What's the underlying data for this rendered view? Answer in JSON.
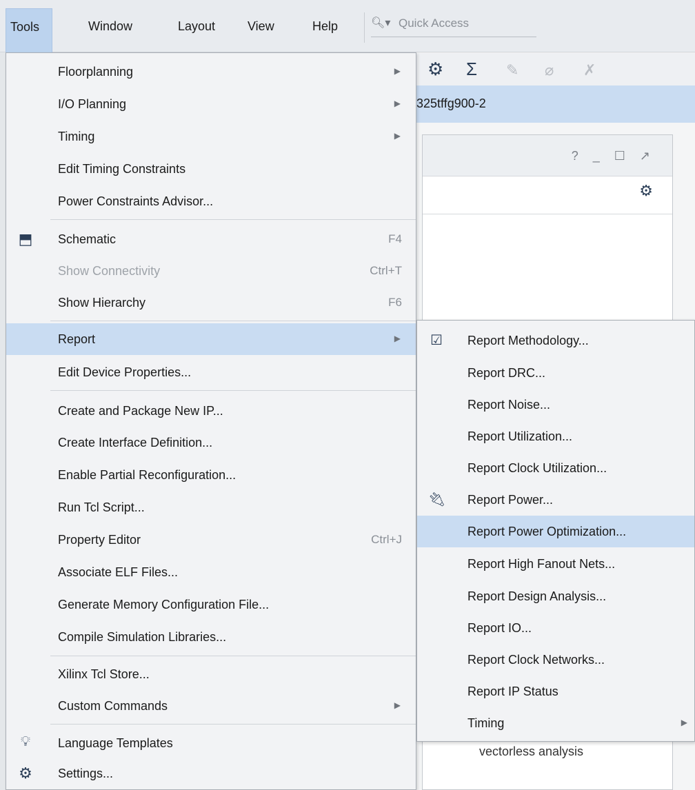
{
  "menubar": {
    "items": [
      {
        "label": "Tools",
        "active": true
      },
      {
        "label": "Window"
      },
      {
        "label": "Layout"
      },
      {
        "label": "View"
      },
      {
        "label": "Help"
      }
    ],
    "quick_access_placeholder": "Quick Access"
  },
  "workspace": {
    "part_number": "325tffg900-2",
    "panel_controls": "? _ ☐ ↗",
    "peek_text": "vectorless analysis"
  },
  "tools_menu": {
    "items": [
      {
        "label": "Floorplanning",
        "submenu": true
      },
      {
        "label": "I/O Planning",
        "submenu": true
      },
      {
        "label": "Timing",
        "submenu": true
      },
      {
        "label": "Edit Timing Constraints"
      },
      {
        "label": "Power Constraints Advisor..."
      },
      {
        "label": "Schematic",
        "shortcut": "F4",
        "icon": "schematic-icon"
      },
      {
        "label": "Show Connectivity",
        "shortcut": "Ctrl+T",
        "disabled": true
      },
      {
        "label": "Show Hierarchy",
        "shortcut": "F6"
      },
      {
        "label": "Report",
        "submenu": true,
        "highlighted": true
      },
      {
        "label": "Edit Device Properties..."
      },
      {
        "label": "Create and Package New IP..."
      },
      {
        "label": "Create Interface Definition..."
      },
      {
        "label": "Enable Partial Reconfiguration..."
      },
      {
        "label": "Run Tcl Script..."
      },
      {
        "label": "Property Editor",
        "shortcut": "Ctrl+J"
      },
      {
        "label": "Associate ELF Files..."
      },
      {
        "label": "Generate Memory Configuration File..."
      },
      {
        "label": "Compile Simulation Libraries..."
      },
      {
        "label": "Xilinx Tcl Store..."
      },
      {
        "label": "Custom Commands",
        "submenu": true
      },
      {
        "label": "Language Templates",
        "icon": "lightbulb-icon"
      },
      {
        "label": "Settings...",
        "icon": "gear-icon"
      }
    ]
  },
  "report_submenu": {
    "items": [
      {
        "label": "Report Methodology...",
        "icon": "clipboard-check-icon"
      },
      {
        "label": "Report DRC..."
      },
      {
        "label": "Report Noise..."
      },
      {
        "label": "Report Utilization..."
      },
      {
        "label": "Report Clock Utilization..."
      },
      {
        "label": "Report Power...",
        "icon": "power-plug-icon"
      },
      {
        "label": "Report Power Optimization...",
        "highlighted": true
      },
      {
        "label": "Report High Fanout Nets..."
      },
      {
        "label": "Report Design Analysis..."
      },
      {
        "label": "Report IO..."
      },
      {
        "label": "Report Clock Networks..."
      },
      {
        "label": "Report IP Status"
      },
      {
        "label": "Timing",
        "submenu": true
      }
    ]
  }
}
